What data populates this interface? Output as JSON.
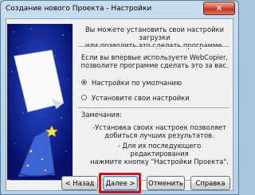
{
  "window": {
    "title": "Создание нового Проекта - Настройки",
    "close_glyph": "✕"
  },
  "content": {
    "intro": [
      "Вы можете установить свои настройки загрузки",
      "или позволить это сделать программе."
    ],
    "first_time": [
      "Если вы впервые используете WebCopier,",
      "позволите программе сделать это за вас."
    ],
    "radio_default": "Настройки по умолчанию",
    "radio_custom": "Установите свои настройки",
    "notes_label": "Замечания:",
    "note1": [
      "-Установка своих настроек позволяет",
      "добиться лучших результатов."
    ],
    "note2": [
      "- Для их последующего редактирования",
      "нажмите кнопку \"Настройки Проекта\"."
    ]
  },
  "buttons": {
    "back": "< Назад",
    "next": "Далее >",
    "cancel": "Отменить",
    "help": "Справка"
  },
  "colors": {
    "highlight": "#c4161c",
    "art_bg": "#0a1a8a"
  }
}
